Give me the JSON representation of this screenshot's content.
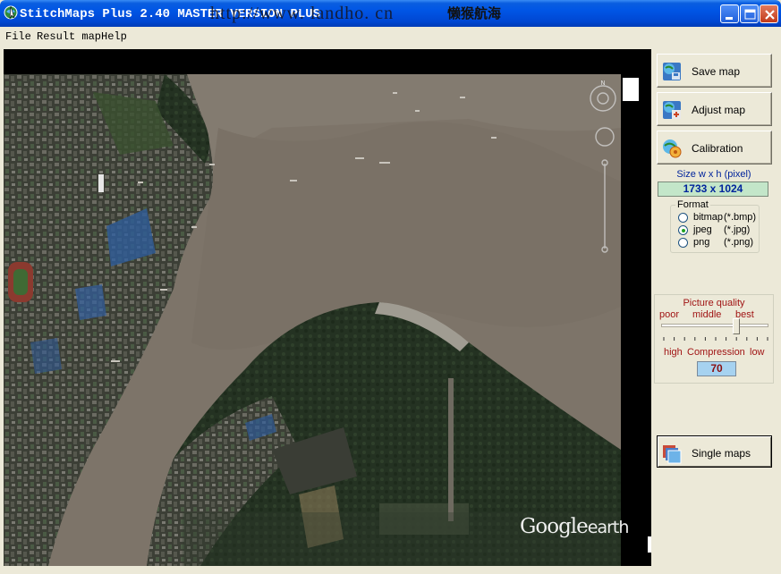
{
  "window": {
    "title": "StitchMaps Plus 2.40 MASTER VERSION PLUS",
    "watermark_url": "http://www. landho. cn",
    "watermark_cn": "懒猴航海",
    "buttons": [
      "minimize-icon",
      "maximize-icon",
      "close-icon"
    ]
  },
  "menu": {
    "items": [
      "File",
      "Result map",
      "Help"
    ]
  },
  "map": {
    "brand": "Google",
    "brand_suffix": "earth"
  },
  "panel": {
    "save_label": "Save map",
    "adjust_label": "Adjust map",
    "calibration_label": "Calibration",
    "size_label": "Size w x h (pixel)",
    "size_value": "1733 x 1024",
    "format": {
      "legend": "Format",
      "options": [
        {
          "name": "bitmap",
          "ext": "(*.bmp)",
          "selected": false
        },
        {
          "name": "jpeg",
          "ext": "(*.jpg)",
          "selected": true
        },
        {
          "name": "png",
          "ext": "(*.png)",
          "selected": false
        }
      ]
    },
    "quality": {
      "title": "Picture quality",
      "poor": "poor",
      "middle": "middle",
      "best": "best",
      "high": "high",
      "compression": "Compression",
      "low": "low",
      "compression_value": "70",
      "slider_level": 0.7
    },
    "single_label": "Single maps"
  },
  "colors": {
    "titlebar": "#0055e5",
    "river": "#7d7469",
    "size_box": "#c3e6c9",
    "quality_text": "#a01414"
  }
}
